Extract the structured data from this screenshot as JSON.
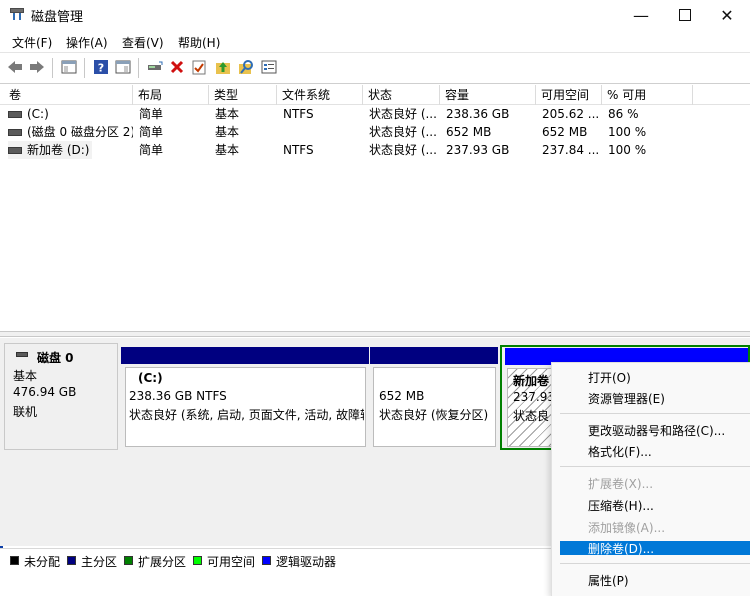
{
  "window": {
    "title": "磁盘管理",
    "buttons": [
      "minimize",
      "maximize",
      "close"
    ]
  },
  "menu": {
    "file": "文件(F)",
    "action": "操作(A)",
    "view": "查看(V)",
    "help": "帮助(H)"
  },
  "toolbar": {
    "icons": [
      "back-icon",
      "forward-icon",
      "show-hide-console-tree-icon",
      "help-icon",
      "show-hide-action-pane-icon",
      "connect-disk-icon",
      "delete-icon",
      "check-icon",
      "up-folder-icon",
      "search-disk-icon",
      "properties-icon"
    ]
  },
  "volumes": {
    "columns": [
      "卷",
      "布局",
      "类型",
      "文件系统",
      "状态",
      "容量",
      "可用空间",
      "% 可用"
    ],
    "rows": [
      [
        "(C:)",
        "简单",
        "基本",
        "NTFS",
        "状态良好 (...",
        "238.36 GB",
        "205.62 ...",
        "86 %"
      ],
      [
        "(磁盘 0 磁盘分区 2)",
        "简单",
        "基本",
        "",
        "状态良好 (...",
        "652 MB",
        "652 MB",
        "100 %"
      ],
      [
        "新加卷 (D:)",
        "简单",
        "基本",
        "NTFS",
        "状态良好 (...",
        "237.93 GB",
        "237.84 ...",
        "100 %"
      ]
    ]
  },
  "disk0": {
    "name": "磁盘 0",
    "type": "基本",
    "size": "476.94 GB",
    "status": "联机",
    "partitions": [
      {
        "name": "(C:)",
        "size": "238.36 GB NTFS",
        "status": "状态良好 (系统, 启动, 页面文件, 活动, 故障转"
      },
      {
        "name": "",
        "size": "652 MB",
        "status": "状态良好 (恢复分区)"
      },
      {
        "name": "新加卷",
        "size": "237.93",
        "status": "状态良"
      }
    ]
  },
  "legend": {
    "items": [
      {
        "label": "未分配",
        "color": "#000000"
      },
      {
        "label": "主分区",
        "color": "#000080"
      },
      {
        "label": "扩展分区",
        "color": "#008000"
      },
      {
        "label": "可用空间",
        "color": "#00ff00"
      },
      {
        "label": "逻辑驱动器",
        "color": "#0000ff"
      }
    ]
  },
  "context_menu": {
    "open": "打开(O)",
    "explorer": "资源管理器(E)",
    "change_letter": "更改驱动器号和路径(C)...",
    "format": "格式化(F)...",
    "extend": "扩展卷(X)...",
    "shrink": "压缩卷(H)...",
    "add_mirror": "添加镜像(A)...",
    "delete": "删除卷(D)...",
    "properties": "属性(P)"
  },
  "colors": {
    "primary_partition_bar": "#000080",
    "logical_drive_bar": "#0000ff",
    "selection_border": "#008000",
    "context_highlight": "#0078d7"
  }
}
